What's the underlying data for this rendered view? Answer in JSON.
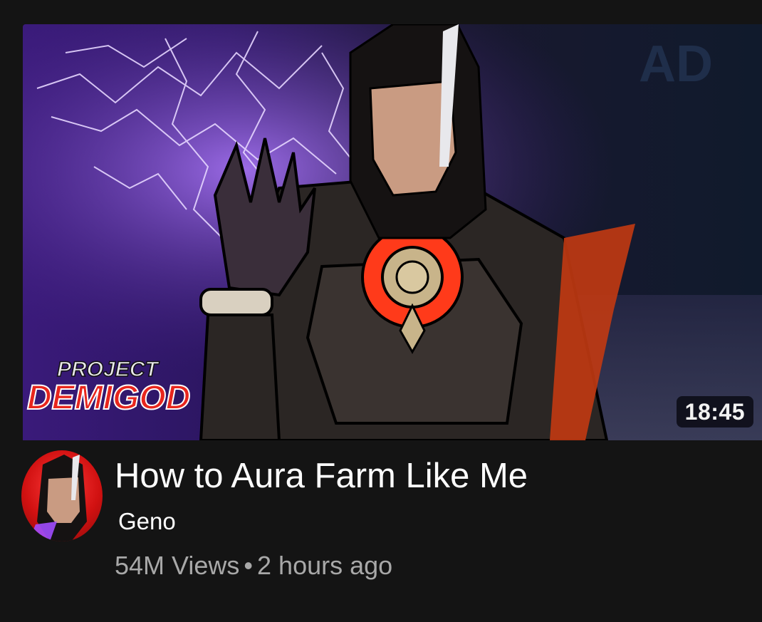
{
  "video": {
    "title": "How to Aura Farm Like Me",
    "channel": "Geno",
    "views": "54M Views",
    "separator": "•",
    "age": "2 hours ago",
    "duration": "18:45"
  },
  "thumbnail": {
    "logo_line1": "PROJECT",
    "logo_line2": "DEMIGOD",
    "corner_text": "AD"
  },
  "colors": {
    "background": "#141414",
    "title": "#ffffff",
    "meta": "#a8a8a8",
    "avatar_bg": "#d11111",
    "lightning": "#c9a6ff",
    "core": "#ff3a1a"
  }
}
